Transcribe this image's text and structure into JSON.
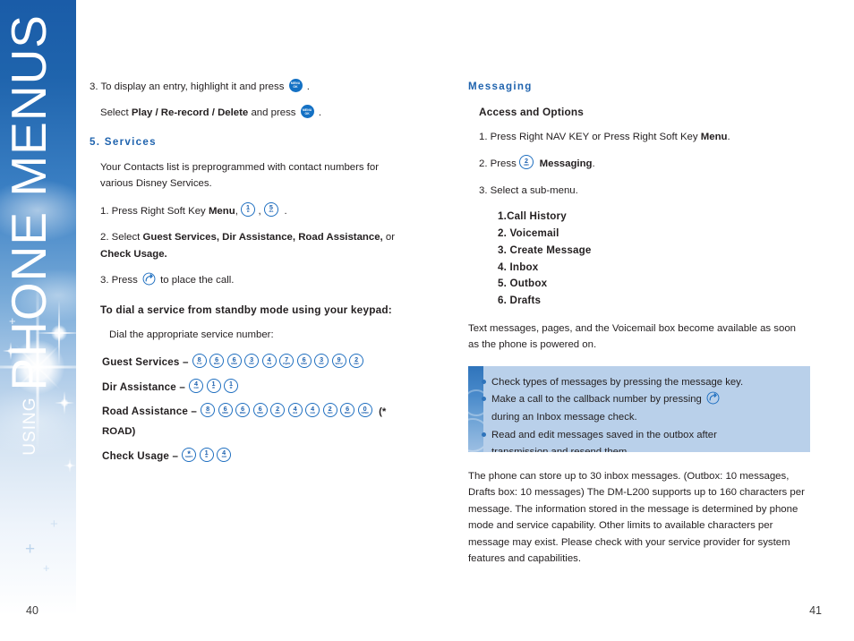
{
  "sidebar": {
    "using_label": "USING",
    "title": "PHONE MENUS"
  },
  "left_column": {
    "step3_display": {
      "prefix": "3. To display an entry, highlight it and press",
      "suffix": "."
    },
    "select_line": {
      "prefix": "Select",
      "bold": "Play / Re-record / Delete",
      "middle": "and press",
      "suffix": "."
    },
    "services_heading": "5. Services",
    "services_intro": "Your Contacts list is preprogrammed with contact numbers for various Disney Services.",
    "step1": {
      "prefix": "1. Press Right Soft Key",
      "bold": "Menu",
      "comma": ",",
      "suffix": "."
    },
    "step2": {
      "prefix": "2. Select",
      "bold1": "Guest Services, Dir Assistance, Road Assistance,",
      "middle": "or",
      "bold2": "Check Usage."
    },
    "step3_call": {
      "prefix": "3. Press",
      "suffix": "to place the call."
    },
    "dial_heading": "To dial a service from standby mode using your keypad:",
    "dial_intro": "Dial the appropriate service number:",
    "dial_entries": [
      {
        "label": "Guest Services –",
        "digits": [
          "8",
          "6",
          "6",
          "3",
          "4",
          "7",
          "6",
          "3",
          "9",
          "2"
        ],
        "tag": ""
      },
      {
        "label": "Dir Assistance –",
        "digits": [
          "4",
          "1",
          "1"
        ],
        "tag": ""
      },
      {
        "label": "Road Assistance –",
        "digits": [
          "8",
          "6",
          "6",
          "6",
          "2",
          "4",
          "4",
          "2",
          "6",
          "0"
        ],
        "tag": "(* ROAD)"
      },
      {
        "label": "Check Usage –",
        "digits": [
          "*",
          "1",
          "4"
        ],
        "tag": ""
      }
    ],
    "page_number": "40"
  },
  "right_column": {
    "messaging_heading": "Messaging",
    "access_heading": "Access and Options",
    "step1": {
      "prefix": "1. Press Right NAV KEY or  Press Right Soft Key",
      "bold": "Menu",
      "suffix": "."
    },
    "step2": {
      "prefix": "2. Press",
      "bold": "Messaging",
      "suffix": "."
    },
    "step3": "3. Select a sub-menu.",
    "submenu": [
      "1.Call History",
      "2. Voicemail",
      "3. Create Message",
      "4. Inbox",
      "5. Outbox",
      "6. Drafts"
    ],
    "availability_text": "Text messages, pages, and the Voicemail box become available as soon as the phone is powered on.",
    "note_box": {
      "bullets": [
        {
          "before": "Check types of messages by pressing the message key.",
          "icon": "",
          "after": ""
        },
        {
          "before": "Make a call to the callback number by pressing",
          "icon": "send-key",
          "after": "during an Inbox message check."
        },
        {
          "before": "Read and edit messages saved in the outbox after",
          "icon": "",
          "after": "transmission and resend them."
        }
      ]
    },
    "storage_text": "The phone can store up to 30 inbox messages. (Outbox: 10 messages, Drafts box: 10 messages) The DM-L200 supports up to 160 characters per message. The information stored in the message is determined by phone mode and service capability. Other limits to available characters per message may exist. Please check with your service provider for system features and capabilities.",
    "page_number": "41"
  },
  "keypad_letters": {
    "0": "OPER",
    "1": "✉",
    "2": "ABC",
    "3": "DEF",
    "4": "GHI",
    "5": "JKL",
    "6": "MNO",
    "7": "PQRS",
    "8": "TUV",
    "9": "WXYZ",
    "*": "SHIFT"
  },
  "icon_labels": {
    "menu_top": "MENU",
    "menu_bottom": "OK"
  },
  "colors": {
    "heading_blue": "#1f63ae",
    "key_blue": "#1f6fc0",
    "menu_key_fill": "#1471c4",
    "note_bg": "#b9d0ea",
    "note_stripe": "#2f74bb",
    "sidebar_top": "#1a5ca8"
  }
}
